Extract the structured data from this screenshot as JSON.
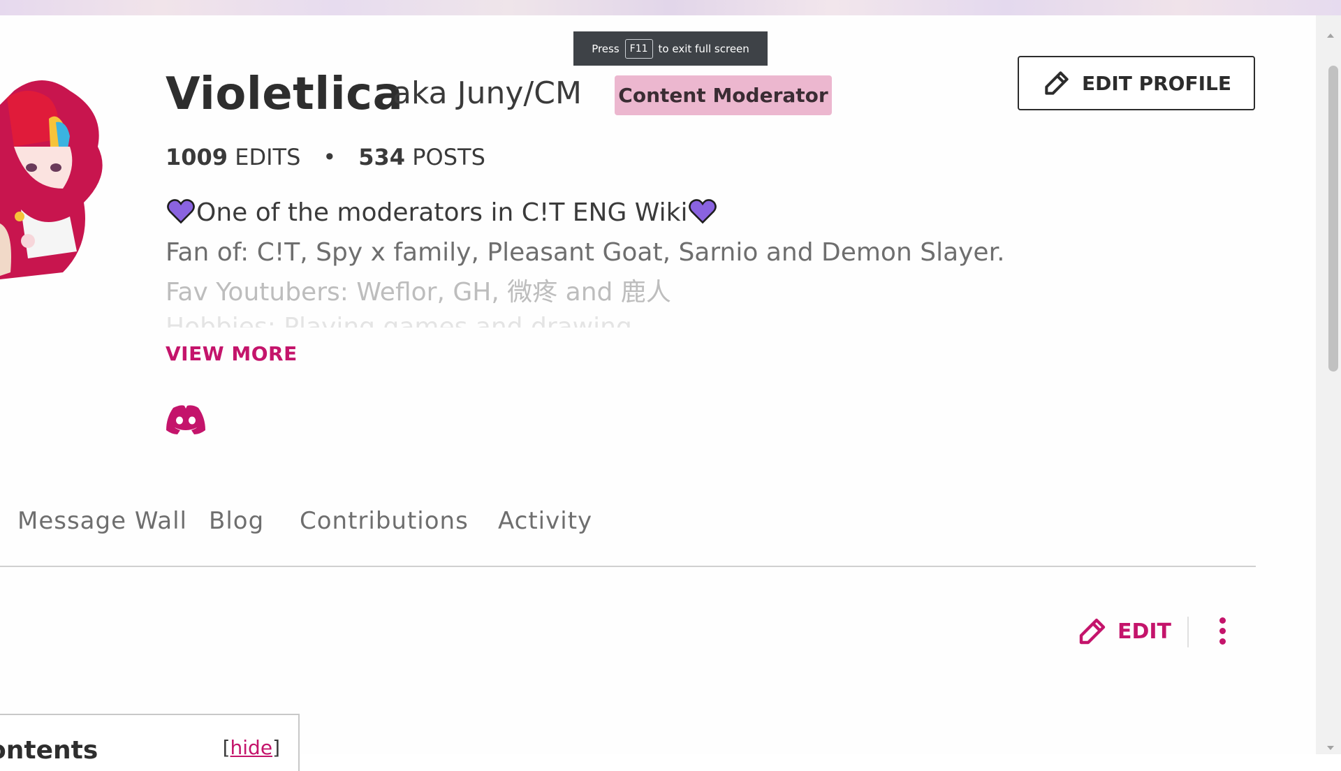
{
  "fullscreen_toast": {
    "press": "Press",
    "key": "F11",
    "suffix": "to exit full screen"
  },
  "profile": {
    "username": "Violetlica",
    "aka": "aka Juny/CM",
    "badge": "Content Moderator",
    "edit_profile_label": "EDIT PROFILE",
    "stats": {
      "edits_count": "1009",
      "edits_label": "EDITS",
      "separator": "•",
      "posts_count": "534",
      "posts_label": "POSTS"
    },
    "bio": {
      "line1": "One of the moderators in C!T ENG Wiki",
      "line2": "Fan of: C!T, Spy x family, Pleasant Goat, Sarnio and Demon Slayer.",
      "line3": "Fav Youtubers: Weflor, GH, 微疼 and 鹿人",
      "line4": "Hobbies: Playing games and drawing"
    },
    "view_more_label": "VIEW MORE",
    "social": {
      "icon": "discord-icon"
    }
  },
  "tabs": [
    {
      "label": "Message Wall"
    },
    {
      "label": "Blog"
    },
    {
      "label": "Contributions"
    },
    {
      "label": "Activity"
    }
  ],
  "actions": {
    "edit_label": "EDIT"
  },
  "toc": {
    "title": "ontents",
    "hide_open": "[",
    "hide_label": "hide",
    "hide_close": "]"
  },
  "colors": {
    "accent": "#c4146b",
    "badge_bg": "#ecb7cf",
    "heart": "#8a63e0",
    "text": "#3a3a3a"
  }
}
